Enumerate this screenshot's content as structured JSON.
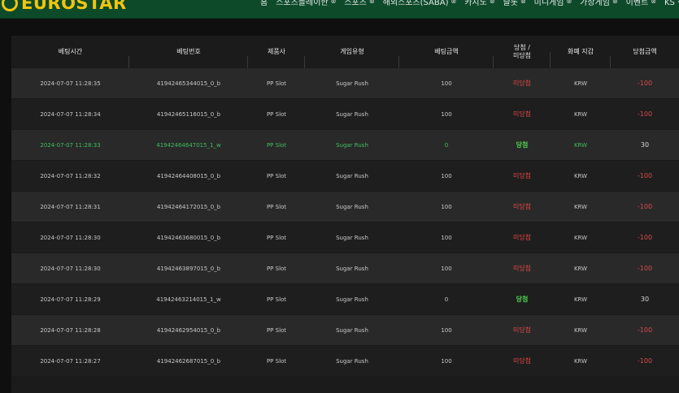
{
  "brand": {
    "name": "EUROSTAR"
  },
  "nav": [
    "홈",
    "스포츠플레이한",
    "스포츠",
    "해외스포츠(SABA)",
    "카지노",
    "슬롯",
    "미니게임",
    "가상게임",
    "이벤트",
    "KS 석토가기"
  ],
  "table": {
    "headers": {
      "bet_time": "베팅시간",
      "bet_no": "베팅번호",
      "provider": "제품사",
      "game_type": "게임유형",
      "bet_amount": "베팅금액",
      "result_line1": "당첨 /",
      "result_line2": "미당첨",
      "currency": "화폐 지갑",
      "win_amount": "당첨금액"
    },
    "rows": [
      {
        "time": "2024-07-07 11:28:35",
        "bet_no": "41942465344015_0_b",
        "provider": "PP Slot",
        "game": "Sugar Rush",
        "amount": "100",
        "result": "미당첨",
        "currency": "KRW",
        "win": "-100",
        "status": "lose"
      },
      {
        "time": "2024-07-07 11:28:34",
        "bet_no": "41942465116015_0_b",
        "provider": "PP Slot",
        "game": "Sugar Rush",
        "amount": "100",
        "result": "미당첨",
        "currency": "KRW",
        "win": "-100",
        "status": "lose"
      },
      {
        "time": "2024-07-07 11:28:33",
        "bet_no": "41942464647015_1_w",
        "provider": "PP Slot",
        "game": "Sugar Rush",
        "amount": "0",
        "result": "당첨",
        "currency": "KRW",
        "win": "30",
        "status": "win"
      },
      {
        "time": "2024-07-07 11:28:32",
        "bet_no": "41942464408015_0_b",
        "provider": "PP Slot",
        "game": "Sugar Rush",
        "amount": "100",
        "result": "미당첨",
        "currency": "KRW",
        "win": "-100",
        "status": "lose"
      },
      {
        "time": "2024-07-07 11:28:31",
        "bet_no": "41942464172015_0_b",
        "provider": "PP Slot",
        "game": "Sugar Rush",
        "amount": "100",
        "result": "미당첨",
        "currency": "KRW",
        "win": "-100",
        "status": "lose"
      },
      {
        "time": "2024-07-07 11:28:30",
        "bet_no": "41942463680015_0_b",
        "provider": "PP Slot",
        "game": "Sugar Rush",
        "amount": "100",
        "result": "미당첨",
        "currency": "KRW",
        "win": "-100",
        "status": "lose"
      },
      {
        "time": "2024-07-07 11:28:30",
        "bet_no": "41942463897015_0_b",
        "provider": "PP Slot",
        "game": "Sugar Rush",
        "amount": "100",
        "result": "미당첨",
        "currency": "KRW",
        "win": "-100",
        "status": "lose"
      },
      {
        "time": "2024-07-07 11:28:29",
        "bet_no": "41942463214015_1_w",
        "provider": "PP Slot",
        "game": "Sugar Rush",
        "amount": "0",
        "result": "당첨",
        "currency": "KRW",
        "win": "30",
        "status": "win2"
      },
      {
        "time": "2024-07-07 11:28:28",
        "bet_no": "41942462954015_0_b",
        "provider": "PP Slot",
        "game": "Sugar Rush",
        "amount": "100",
        "result": "미당첨",
        "currency": "KRW",
        "win": "-100",
        "status": "lose"
      },
      {
        "time": "2024-07-07 11:28:27",
        "bet_no": "41942462687015_0_b",
        "provider": "PP Slot",
        "game": "Sugar Rush",
        "amount": "100",
        "result": "미당첨",
        "currency": "KRW",
        "win": "-100",
        "status": "lose"
      }
    ]
  },
  "colors": {
    "topbar": "#0d4a2a",
    "brand": "#f1c40f",
    "lose": "#e24545",
    "win": "#4fd04f",
    "win_row_text": "#3fbf5f"
  }
}
